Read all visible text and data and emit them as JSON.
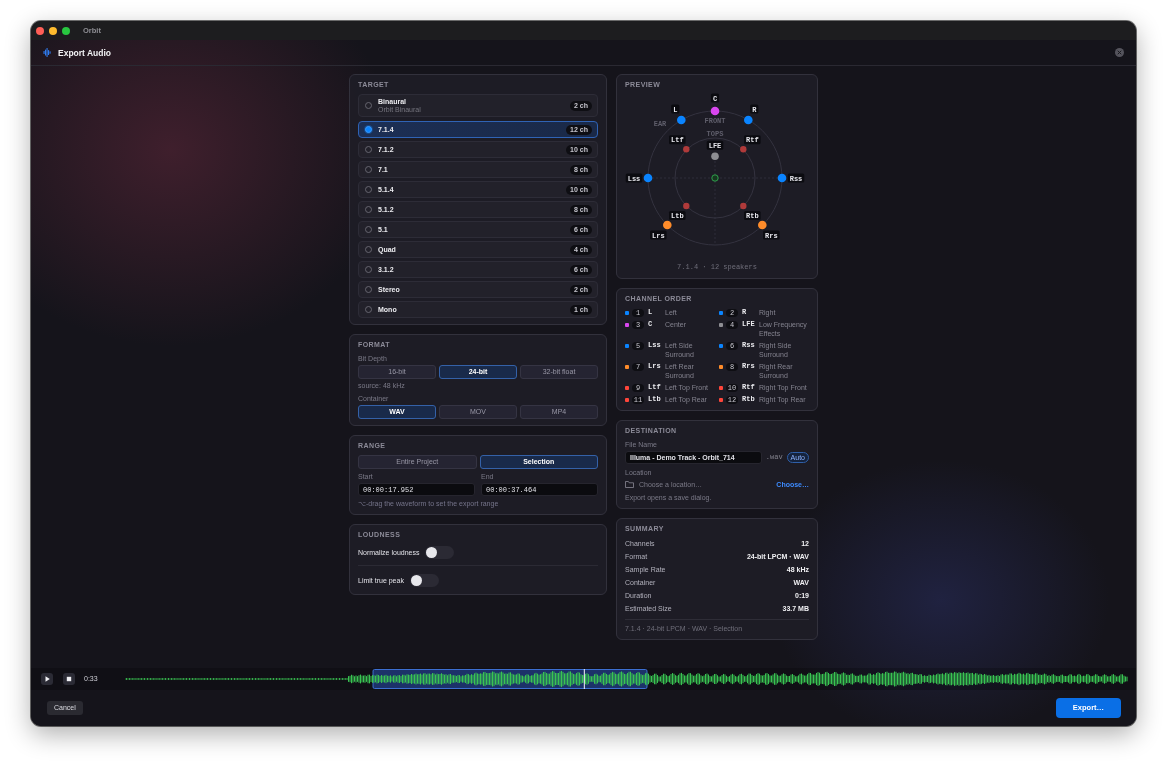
{
  "window": {
    "title": "Orbit"
  },
  "header": {
    "title": "Export Audio"
  },
  "target": {
    "title": "TARGET",
    "options": [
      {
        "label": "Binaural",
        "sublabel": "Orbit Binaural",
        "channels": "2 ch",
        "selected": false
      },
      {
        "label": "7.1.4",
        "channels": "12 ch",
        "selected": true
      },
      {
        "label": "7.1.2",
        "channels": "10 ch",
        "selected": false
      },
      {
        "label": "7.1",
        "channels": "8 ch",
        "selected": false
      },
      {
        "label": "5.1.4",
        "channels": "10 ch",
        "selected": false
      },
      {
        "label": "5.1.2",
        "channels": "8 ch",
        "selected": false
      },
      {
        "label": "5.1",
        "channels": "6 ch",
        "selected": false
      },
      {
        "label": "Quad",
        "channels": "4 ch",
        "selected": false
      },
      {
        "label": "3.1.2",
        "channels": "6 ch",
        "selected": false
      },
      {
        "label": "Stereo",
        "channels": "2 ch",
        "selected": false
      },
      {
        "label": "Mono",
        "channels": "1 ch",
        "selected": false
      }
    ]
  },
  "format": {
    "title": "FORMAT",
    "bit_depth": {
      "label": "Bit Depth",
      "options": [
        {
          "label": "16-bit",
          "selected": false
        },
        {
          "label": "24-bit",
          "selected": true
        },
        {
          "label": "32-bit float",
          "selected": false
        }
      ],
      "note": "source: 48 kHz"
    },
    "container": {
      "label": "Container",
      "options": [
        {
          "label": "WAV",
          "selected": true
        },
        {
          "label": "MOV",
          "selected": false
        },
        {
          "label": "MP4",
          "selected": false
        }
      ]
    }
  },
  "range": {
    "title": "RANGE",
    "options": [
      {
        "label": "Entire Project",
        "selected": false
      },
      {
        "label": "Selection",
        "selected": true
      }
    ],
    "start": {
      "label": "Start",
      "value": "00:00:17.952"
    },
    "end": {
      "label": "End",
      "value": "00:00:37.464"
    },
    "hint": "⌥-drag the waveform to set the export range"
  },
  "loudness": {
    "title": "LOUDNESS",
    "toggles": [
      {
        "label": "Normalize loudness",
        "on": false
      },
      {
        "label": "Limit true peak",
        "on": false
      }
    ]
  },
  "preview": {
    "title": "PREVIEW",
    "ring_labels": [
      "FRONT",
      "EAR",
      "TOPS"
    ],
    "speakers": [
      {
        "label": "C",
        "color": "#d946ef"
      },
      {
        "label": "L",
        "color": "#0a84ff"
      },
      {
        "label": "R",
        "color": "#0a84ff"
      },
      {
        "label": "Ltf",
        "color": "#b03a3a"
      },
      {
        "label": "Rtf",
        "color": "#b03a3a"
      },
      {
        "label": "LFE",
        "color": "#8e8e93"
      },
      {
        "label": "Lss",
        "color": "#0a84ff"
      },
      {
        "label": "Rss",
        "color": "#0a84ff"
      },
      {
        "label": "Ltb",
        "color": "#b03a3a"
      },
      {
        "label": "Rtb",
        "color": "#b03a3a"
      },
      {
        "label": "Lrs",
        "color": "#ff8c2a"
      },
      {
        "label": "Rrs",
        "color": "#ff8c2a"
      }
    ],
    "caption": "7.1.4 · 12 speakers"
  },
  "channel_order": {
    "title": "CHANNEL ORDER",
    "channels": [
      {
        "number": "1",
        "code": "L",
        "name": "Left",
        "color": "#0a84ff"
      },
      {
        "number": "2",
        "code": "R",
        "name": "Right",
        "color": "#0a84ff"
      },
      {
        "number": "3",
        "code": "C",
        "name": "Center",
        "color": "#d946ef"
      },
      {
        "number": "4",
        "code": "LFE",
        "name": "Low Frequency Effects",
        "color": "#8e8e93"
      },
      {
        "number": "5",
        "code": "Lss",
        "name": "Left Side Surround",
        "color": "#0a84ff"
      },
      {
        "number": "6",
        "code": "Rss",
        "name": "Right Side Surround",
        "color": "#0a84ff"
      },
      {
        "number": "7",
        "code": "Lrs",
        "name": "Left Rear Surround",
        "color": "#ff8c2a"
      },
      {
        "number": "8",
        "code": "Rrs",
        "name": "Right Rear Surround",
        "color": "#ff8c2a"
      },
      {
        "number": "9",
        "code": "Ltf",
        "name": "Left Top Front",
        "color": "#ff453a"
      },
      {
        "number": "10",
        "code": "Rtf",
        "name": "Right Top Front",
        "color": "#ff453a"
      },
      {
        "number": "11",
        "code": "Ltb",
        "name": "Left Top Rear",
        "color": "#ff453a"
      },
      {
        "number": "12",
        "code": "Rtb",
        "name": "Right Top Rear",
        "color": "#ff453a"
      }
    ]
  },
  "destination": {
    "title": "DESTINATION",
    "file_name": {
      "label": "File Name",
      "value": "Illuma - Demo Track - Orbit_714",
      "extension": ".wav",
      "auto": "Auto"
    },
    "location": {
      "label": "Location",
      "text": "Choose a location…",
      "action": "Choose…"
    },
    "note": "Export opens a save dialog."
  },
  "summary": {
    "title": "SUMMARY",
    "rows": [
      {
        "label": "Channels",
        "value": "12"
      },
      {
        "label": "Format",
        "value": "24-bit LPCM · WAV"
      },
      {
        "label": "Sample Rate",
        "value": "48 kHz"
      },
      {
        "label": "Container",
        "value": "WAV"
      },
      {
        "label": "Duration",
        "value": "0:19"
      },
      {
        "label": "Estimated Size",
        "value": "33.7 MB"
      }
    ],
    "footer": "7.1.4 · 24-bit LPCM · WAV · Selection"
  },
  "transport": {
    "time": "0:33"
  },
  "footer": {
    "cancel": "Cancel",
    "export": "Export…"
  }
}
